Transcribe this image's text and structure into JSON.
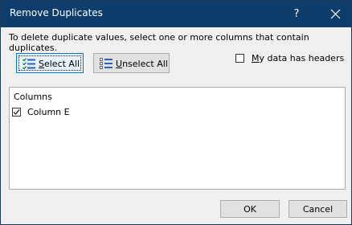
{
  "window": {
    "title": "Remove Duplicates",
    "help_label": "?",
    "close_icon": "close-icon"
  },
  "instructions": "To delete duplicate values, select one or more columns that contain duplicates.",
  "buttons": {
    "select_all": {
      "mnemonic": "S",
      "rest": "elect All",
      "icon": "select-all-icon"
    },
    "unselect_all": {
      "mnemonic": "U",
      "rest": "nselect All",
      "icon": "unselect-all-icon"
    },
    "ok": "OK",
    "cancel": "Cancel"
  },
  "headers_option": {
    "mnemonic": "M",
    "rest": "y data has headers",
    "checked": false
  },
  "columns_list": {
    "header": "Columns",
    "items": [
      {
        "label": "Column E",
        "checked": true
      }
    ]
  },
  "colors": {
    "titlebar": "#0e3c6b",
    "dialog_bg": "#f0f0f0",
    "default_button_border": "#0078d7"
  }
}
